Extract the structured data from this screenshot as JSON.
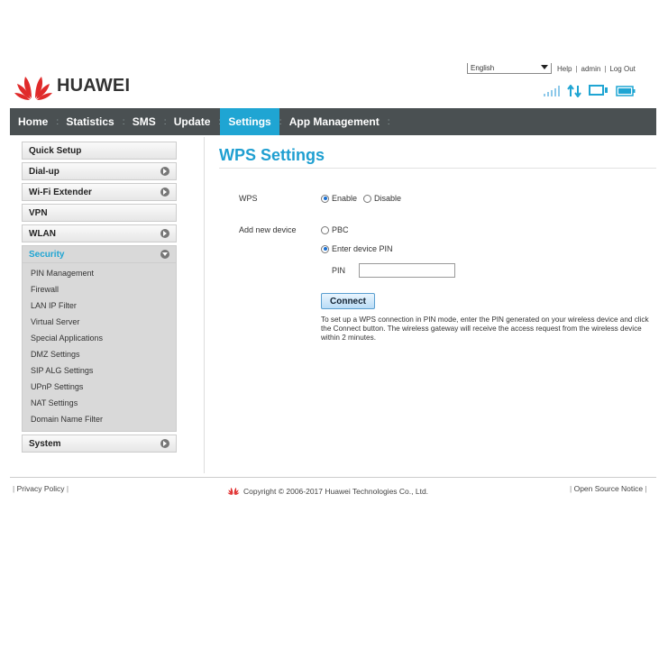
{
  "brand": {
    "name": "HUAWEI",
    "accent": "#1fa5d3",
    "logo_color": "#e02a2a"
  },
  "header": {
    "language": "English",
    "links": [
      "Help",
      "admin",
      "Log Out"
    ]
  },
  "nav": {
    "items": [
      {
        "label": "Home",
        "active": false
      },
      {
        "label": "Statistics",
        "active": false
      },
      {
        "label": "SMS",
        "active": false
      },
      {
        "label": "Update",
        "active": false
      },
      {
        "label": "Settings",
        "active": true
      },
      {
        "label": "App Management",
        "active": false
      }
    ]
  },
  "sidebar": {
    "items": [
      {
        "label": "Quick Setup",
        "arrow": false
      },
      {
        "label": "Dial-up",
        "arrow": true
      },
      {
        "label": "Wi-Fi Extender",
        "arrow": true
      },
      {
        "label": "VPN",
        "arrow": false
      },
      {
        "label": "WLAN",
        "arrow": true
      },
      {
        "label": "Security",
        "arrow": true,
        "open": true
      },
      {
        "label": "System",
        "arrow": true
      }
    ],
    "security_sub": [
      "PIN Management",
      "Firewall",
      "LAN IP Filter",
      "Virtual Server",
      "Special Applications",
      "DMZ Settings",
      "SIP ALG Settings",
      "UPnP Settings",
      "NAT Settings",
      "Domain Name Filter"
    ]
  },
  "content": {
    "title": "WPS Settings",
    "wps_label": "WPS",
    "wps_enable": "Enable",
    "wps_disable": "Disable",
    "add_label": "Add new device",
    "opt_pbc": "PBC",
    "opt_pin": "Enter device PIN",
    "pin_label": "PIN",
    "pin_value": "",
    "connect": "Connect",
    "help": "To set up a WPS connection in PIN mode, enter the PIN generated on your wireless device and click the Connect button. The wireless gateway will receive the access request from the wireless device within 2 minutes."
  },
  "footer": {
    "privacy": "Privacy Policy",
    "copyright": "Copyright © 2006-2017 Huawei Technologies Co., Ltd.",
    "open_source": "Open Source Notice"
  },
  "icons": [
    "huawei-logo",
    "signal-icon",
    "data-transfer-icon",
    "monitor-icon",
    "battery-icon",
    "chevron-right-icon",
    "chevron-down-icon"
  ]
}
